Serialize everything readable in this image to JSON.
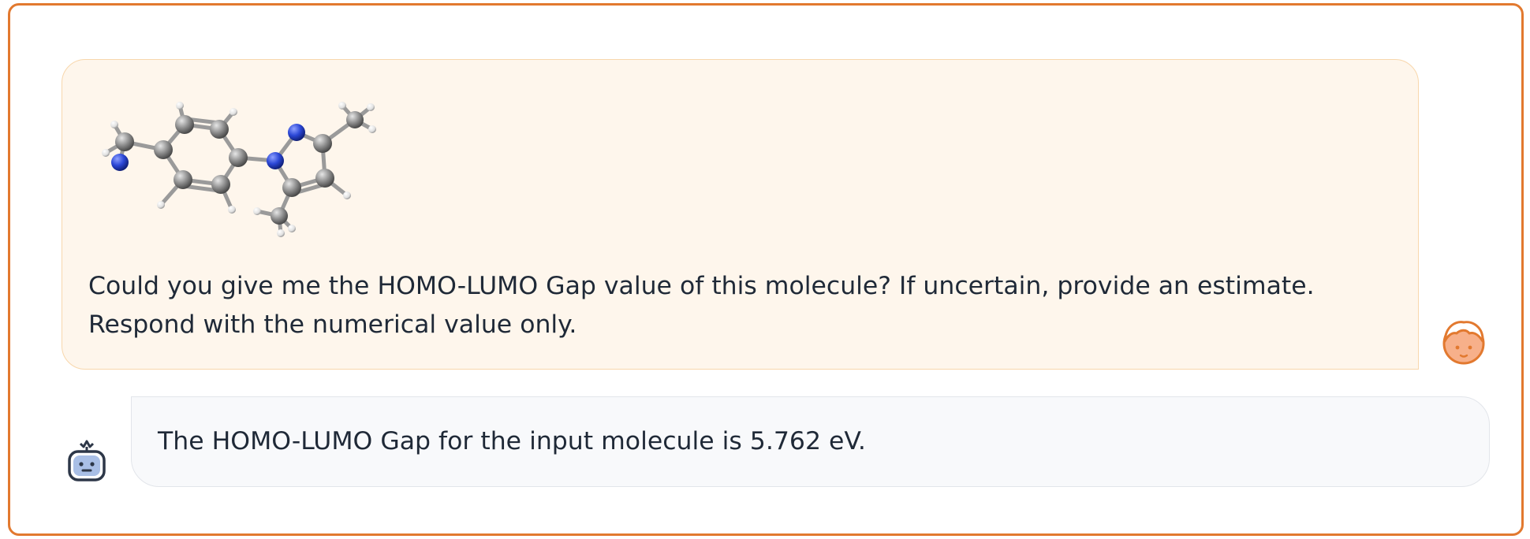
{
  "conversation": {
    "user_message": {
      "text": "Could you give me the HOMO-LUMO Gap value of this molecule? If uncertain, provide an estimate. Respond with the numerical value only.",
      "image": "molecule-3d-ball-and-stick"
    },
    "assistant_message": {
      "text": "The HOMO-LUMO Gap for the input molecule is 5.762 eV."
    },
    "user_avatar_icon": "user-face-icon",
    "bot_avatar_icon": "robot-icon"
  },
  "colors": {
    "frame_border": "#E2792F",
    "user_bubble_bg": "#FEF6EC",
    "user_bubble_border": "#F8D7AC",
    "bot_bubble_bg": "#F8F9FB",
    "bot_bubble_border": "#E2E5EA",
    "text": "#1f2937",
    "carbon": "#8f8f8f",
    "nitrogen": "#2b47d6",
    "hydrogen": "#f0f0f0"
  }
}
